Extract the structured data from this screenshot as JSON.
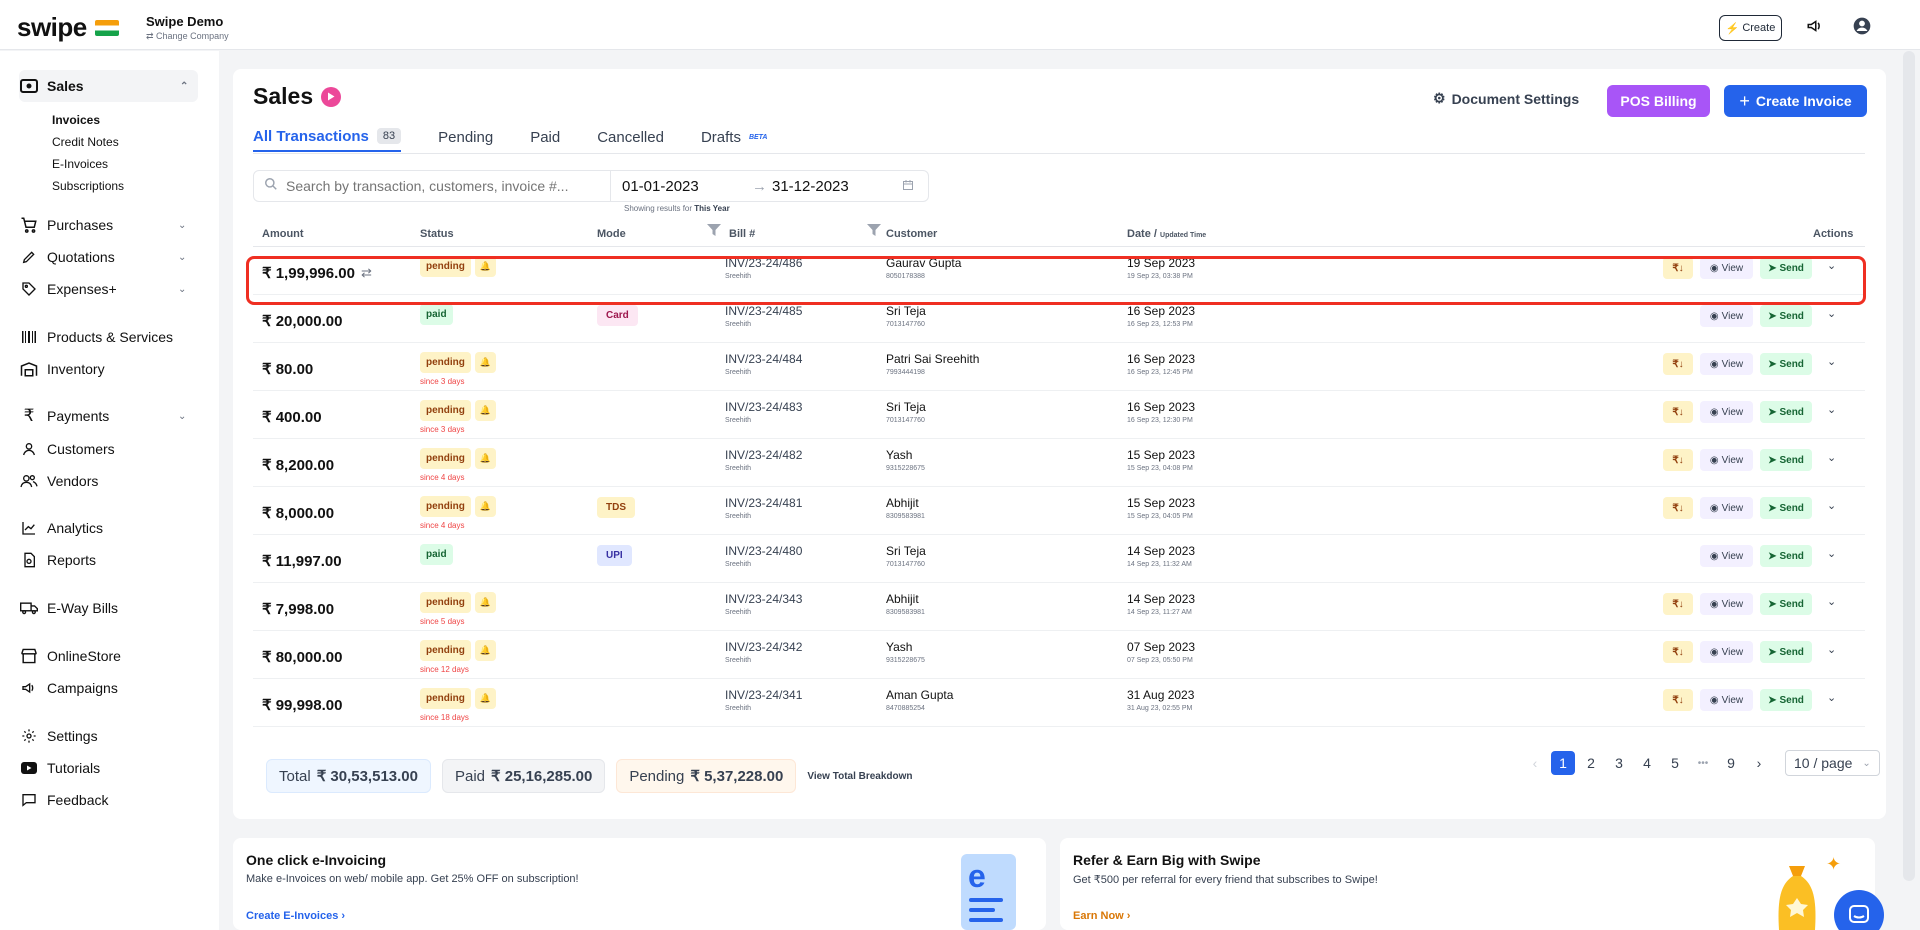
{
  "topbar": {
    "logo": "swipe",
    "company_name": "Swipe Demo",
    "change_company": "⇄ Change Company",
    "create_label": "Create"
  },
  "sidebar": {
    "sales": "Sales",
    "sales_sub": [
      "Invoices",
      "Credit Notes",
      "E-Invoices",
      "Subscriptions"
    ],
    "purchases": "Purchases",
    "quotations": "Quotations",
    "expenses": "Expenses+",
    "products": "Products & Services",
    "inventory": "Inventory",
    "payments": "Payments",
    "customers": "Customers",
    "vendors": "Vendors",
    "analytics": "Analytics",
    "reports": "Reports",
    "eway": "E-Way Bills",
    "onlinestore": "OnlineStore",
    "campaigns": "Campaigns",
    "settings": "Settings",
    "tutorials": "Tutorials",
    "feedback": "Feedback"
  },
  "page": {
    "title": "Sales",
    "doc_settings": "Document Settings",
    "pos_billing": "POS Billing",
    "create_invoice": "Create Invoice"
  },
  "tabs": {
    "all": "All Transactions",
    "all_count": "83",
    "pending": "Pending",
    "paid": "Paid",
    "cancelled": "Cancelled",
    "drafts": "Drafts",
    "beta": "BETA"
  },
  "filters": {
    "search_placeholder": "Search by transaction, customers, invoice #...",
    "date_from": "01-01-2023",
    "date_to": "31-12-2023",
    "hint_prefix": "Showing results for",
    "hint_range": "This Year"
  },
  "table": {
    "headers": {
      "amount": "Amount",
      "status": "Status",
      "mode": "Mode",
      "bill": "Bill #",
      "customer": "Customer",
      "date": "Date /",
      "date_sub": "Updated Time",
      "actions": "Actions"
    },
    "view_label": "View",
    "send_label": "Send",
    "rows": [
      {
        "amount": "₹ 1,99,996.00",
        "status": "pending",
        "since": "",
        "mode": "",
        "bill": "INV/23-24/486",
        "bill_sub": "Sreehith",
        "customer": "Gaurav Gupta",
        "phone": "8050178388",
        "date": "19 Sep 2023",
        "time": "19 Sep 23, 03:38 PM"
      },
      {
        "amount": "₹ 20,000.00",
        "status": "paid",
        "since": "",
        "mode": "Card",
        "bill": "INV/23-24/485",
        "bill_sub": "Sreehith",
        "customer": "Sri Teja",
        "phone": "7013147760",
        "date": "16 Sep 2023",
        "time": "16 Sep 23, 12:53 PM"
      },
      {
        "amount": "₹ 80.00",
        "status": "pending",
        "since": "since 3 days",
        "mode": "",
        "bill": "INV/23-24/484",
        "bill_sub": "Sreehith",
        "customer": "Patri Sai Sreehith",
        "phone": "7993444198",
        "date": "16 Sep 2023",
        "time": "16 Sep 23, 12:45 PM"
      },
      {
        "amount": "₹ 400.00",
        "status": "pending",
        "since": "since 3 days",
        "mode": "",
        "bill": "INV/23-24/483",
        "bill_sub": "Sreehith",
        "customer": "Sri Teja",
        "phone": "7013147760",
        "date": "16 Sep 2023",
        "time": "16 Sep 23, 12:30 PM"
      },
      {
        "amount": "₹ 8,200.00",
        "status": "pending",
        "since": "since 4 days",
        "mode": "",
        "bill": "INV/23-24/482",
        "bill_sub": "Sreehith",
        "customer": "Yash",
        "phone": "9315228675",
        "date": "15 Sep 2023",
        "time": "15 Sep 23, 04:08 PM"
      },
      {
        "amount": "₹ 8,000.00",
        "status": "pending",
        "since": "since 4 days",
        "mode": "TDS",
        "bill": "INV/23-24/481",
        "bill_sub": "Sreehith",
        "customer": "Abhijit",
        "phone": "8309583981",
        "date": "15 Sep 2023",
        "time": "15 Sep 23, 04:05 PM"
      },
      {
        "amount": "₹ 11,997.00",
        "status": "paid",
        "since": "",
        "mode": "UPI",
        "bill": "INV/23-24/480",
        "bill_sub": "Sreehith",
        "customer": "Sri Teja",
        "phone": "7013147760",
        "date": "14 Sep 2023",
        "time": "14 Sep 23, 11:32 AM"
      },
      {
        "amount": "₹ 7,998.00",
        "status": "pending",
        "since": "since 5 days",
        "mode": "",
        "bill": "INV/23-24/343",
        "bill_sub": "Sreehith",
        "customer": "Abhijit",
        "phone": "8309583981",
        "date": "14 Sep 2023",
        "time": "14 Sep 23, 11:27 AM"
      },
      {
        "amount": "₹ 80,000.00",
        "status": "pending",
        "since": "since 12 days",
        "mode": "",
        "bill": "INV/23-24/342",
        "bill_sub": "Sreehith",
        "customer": "Yash",
        "phone": "9315228675",
        "date": "07 Sep 2023",
        "time": "07 Sep 23, 05:50 PM"
      },
      {
        "amount": "₹ 99,998.00",
        "status": "pending",
        "since": "since 18 days",
        "mode": "",
        "bill": "INV/23-24/341",
        "bill_sub": "Sreehith",
        "customer": "Aman Gupta",
        "phone": "8470885254",
        "date": "31 Aug 2023",
        "time": "31 Aug 23, 02:55 PM"
      }
    ]
  },
  "totals": {
    "total_label": "Total",
    "total_value": "₹ 30,53,513.00",
    "paid_label": "Paid",
    "paid_value": "₹ 25,16,285.00",
    "pending_label": "Pending",
    "pending_value": "₹ 5,37,228.00",
    "breakdown": "View Total Breakdown"
  },
  "pagination": {
    "pages": [
      "1",
      "2",
      "3",
      "4",
      "5",
      "•••",
      "9"
    ],
    "current": "1",
    "per_page": "10 / page"
  },
  "promos": {
    "einv_title": "One click e-Invoicing",
    "einv_desc": "Make e-Invoices on web/ mobile app. Get 25% OFF on subscription!",
    "einv_link": "Create E-Invoices ›",
    "refer_title": "Refer & Earn Big with Swipe",
    "refer_desc": "Get ₹500 per referral for every friend that subscribes to Swipe!",
    "refer_link": "Earn Now ›"
  },
  "colors": {
    "accent": "#2563eb",
    "pos": "#a855f7",
    "highlight": "#ef2f22"
  }
}
